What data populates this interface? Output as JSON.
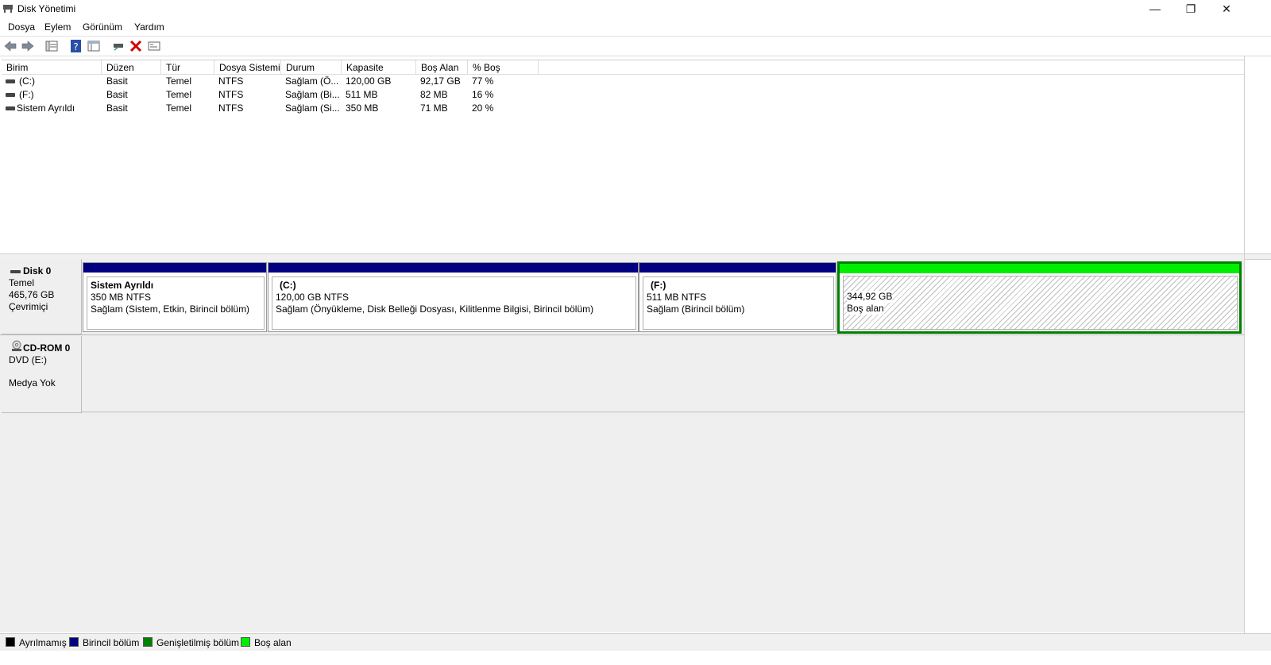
{
  "window": {
    "title": "Disk Yönetimi",
    "minimize": "—",
    "restore": "❐",
    "close": "✕"
  },
  "menu": [
    "Dosya",
    "Eylem",
    "Görünüm",
    "Yardım"
  ],
  "toolbar_icons": [
    "back-icon",
    "forward-icon",
    "properties-list-icon",
    "help-icon",
    "console-view-icon",
    "connect-icon",
    "delete-icon",
    "properties-icon"
  ],
  "columns": [
    "Birim",
    "Düzen",
    "Tür",
    "Dosya Sistemi",
    "Durum",
    "Kapasite",
    "Boş Alan",
    "% Boş"
  ],
  "volumes": [
    {
      "name": "(C:)",
      "layout": "Basit",
      "type": "Temel",
      "fs": "NTFS",
      "status": "Sağlam (Ö...",
      "capacity": "120,00 GB",
      "free": "92,17 GB",
      "pct": "77 %"
    },
    {
      "name": "(F:)",
      "layout": "Basit",
      "type": "Temel",
      "fs": "NTFS",
      "status": "Sağlam (Bi...",
      "capacity": "511 MB",
      "free": "82 MB",
      "pct": "16 %"
    },
    {
      "name": "Sistem Ayrıldı",
      "layout": "Basit",
      "type": "Temel",
      "fs": "NTFS",
      "status": "Sağlam (Si...",
      "capacity": "350 MB",
      "free": "71 MB",
      "pct": "20 %"
    }
  ],
  "disks": {
    "disk0": {
      "name": "Disk 0",
      "type": "Temel",
      "size": "465,76 GB",
      "state": "Çevrimiçi",
      "partitions": [
        {
          "title": "Sistem Ayrıldı",
          "size_fs": "350 MB NTFS",
          "status": "Sağlam (Sistem, Etkin, Birincil bölüm)"
        },
        {
          "title": "(C:)",
          "size_fs": "120,00 GB NTFS",
          "status": "Sağlam (Önyükleme, Disk Belleği Dosyası, Kilitlenme Bilgisi, Birincil bölüm)"
        },
        {
          "title": "(F:)",
          "size_fs": "511 MB NTFS",
          "status": "Sağlam (Birincil bölüm)"
        }
      ],
      "free": {
        "size": "344,92 GB",
        "label": "Boş alan"
      }
    },
    "cdrom0": {
      "name": "CD-ROM 0",
      "drive": "DVD (E:)",
      "media": "Medya Yok"
    }
  },
  "legend": [
    {
      "label": "Ayrılmamış",
      "color": "#000000"
    },
    {
      "label": "Birincil bölüm",
      "color": "#000080"
    },
    {
      "label": "Genişletilmiş bölüm",
      "color": "#008000"
    },
    {
      "label": "Boş alan",
      "color": "#00ee00"
    }
  ],
  "colors": {
    "primary_bar": "#000080",
    "free_bar": "#00ee00",
    "selected_border": "#008000"
  }
}
